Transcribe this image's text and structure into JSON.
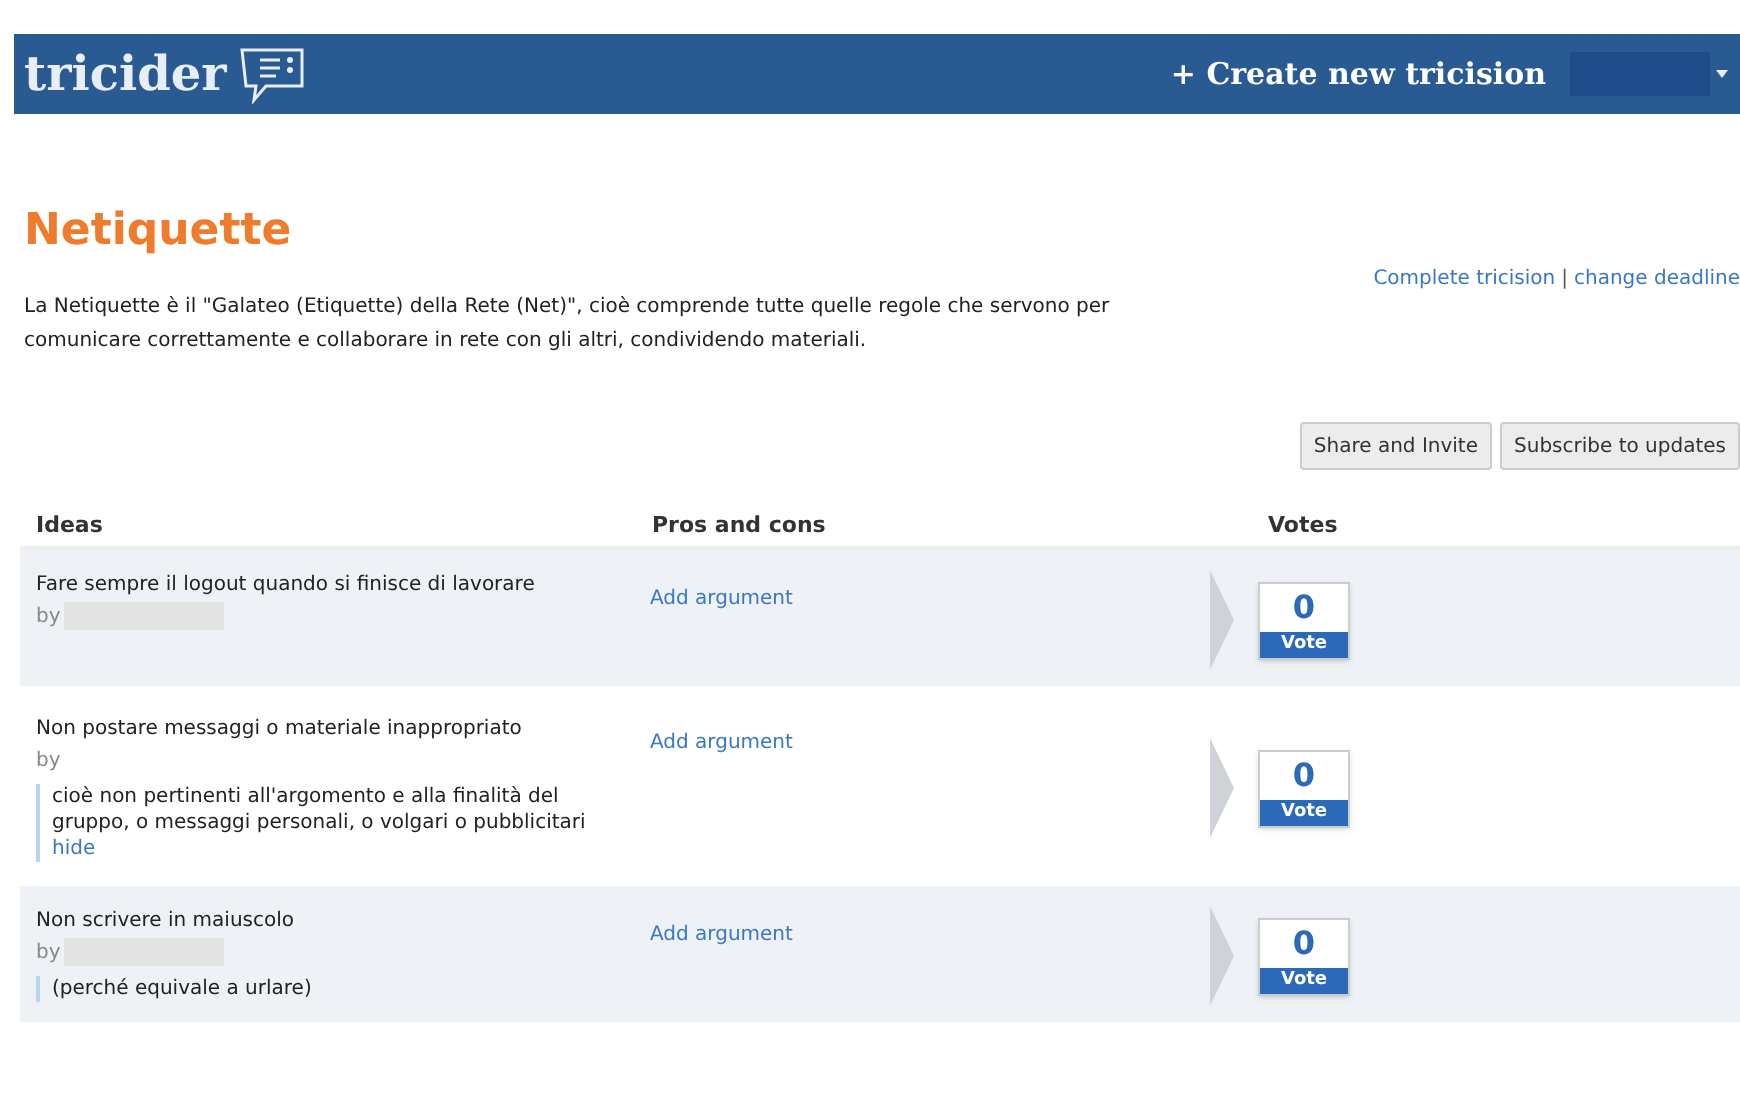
{
  "header": {
    "logo": "tricider",
    "create_link": "+ Create new tricision"
  },
  "title": "Netiquette",
  "description": "La Netiquette è il \"Galateo (Etiquette) della Rete (Net)\", cioè comprende tutte quelle regole che servono per comunicare correttamente e collaborare in rete con gli altri, condividendo materiali.",
  "admin_links": [
    "Complete tricision",
    "change deadline"
  ],
  "admin_separator": "|",
  "actions": [
    "Share and Invite",
    "Subscribe to updates"
  ],
  "table": {
    "columns": [
      "Ideas",
      "Pros and cons",
      "Votes"
    ],
    "rows": [
      {
        "idea": "Fare sempre il logout quando si finisce di lavorare",
        "by": "by",
        "author_hidden": true,
        "add_argument": "Add argument",
        "votes": "0",
        "vote_label": "Vote"
      },
      {
        "idea": "Non postare messaggi o materiale inappropriato",
        "by": "by",
        "author_hidden": false,
        "note": "cioè non pertinenti all'argomento e alla finalità del gruppo, o messaggi personali, o volgari o pubblicitari",
        "hide_link": "hide",
        "add_argument": "Add argument",
        "votes": "0",
        "vote_label": "Vote"
      },
      {
        "idea": "Non scrivere in maiuscolo",
        "by": "by",
        "author_hidden": true,
        "note": "(perché equivale a urlare)",
        "add_argument": "Add argument",
        "votes": "0",
        "vote_label": "Vote"
      }
    ]
  }
}
